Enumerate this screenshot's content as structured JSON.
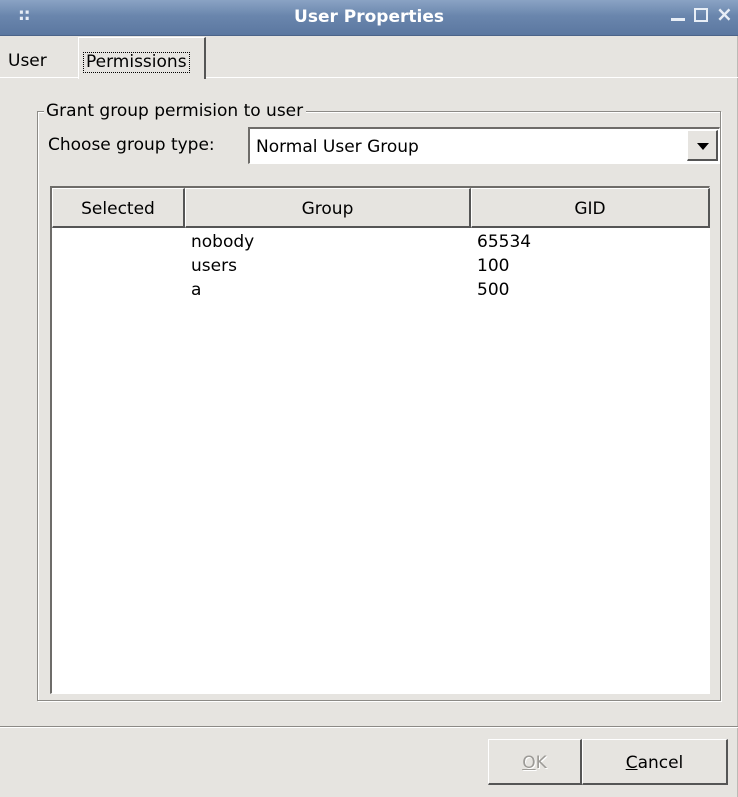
{
  "window": {
    "title": "User Properties",
    "grip": "::",
    "close_glyph": "×"
  },
  "tabs": [
    {
      "label": "User",
      "active": false
    },
    {
      "label": "Permissions",
      "active": true
    }
  ],
  "frame": {
    "legend": "Grant group permision to user",
    "choose_label": "Choose group type:",
    "group_type_value": "Normal User Group"
  },
  "table": {
    "columns": [
      "Selected",
      "Group",
      "GID"
    ],
    "rows": [
      {
        "selected": "",
        "group": "nobody",
        "gid": "65534"
      },
      {
        "selected": "",
        "group": "users",
        "gid": "100"
      },
      {
        "selected": "",
        "group": "a",
        "gid": "500"
      }
    ]
  },
  "buttons": {
    "ok": {
      "mnemonic": "O",
      "rest": "K",
      "enabled": false
    },
    "cancel": {
      "mnemonic": "C",
      "rest": "ancel",
      "enabled": true
    }
  },
  "colors": {
    "titlebar": "#6a86ad",
    "window_bg": "#e6e4e0",
    "disabled_text": "#9c9a96"
  }
}
